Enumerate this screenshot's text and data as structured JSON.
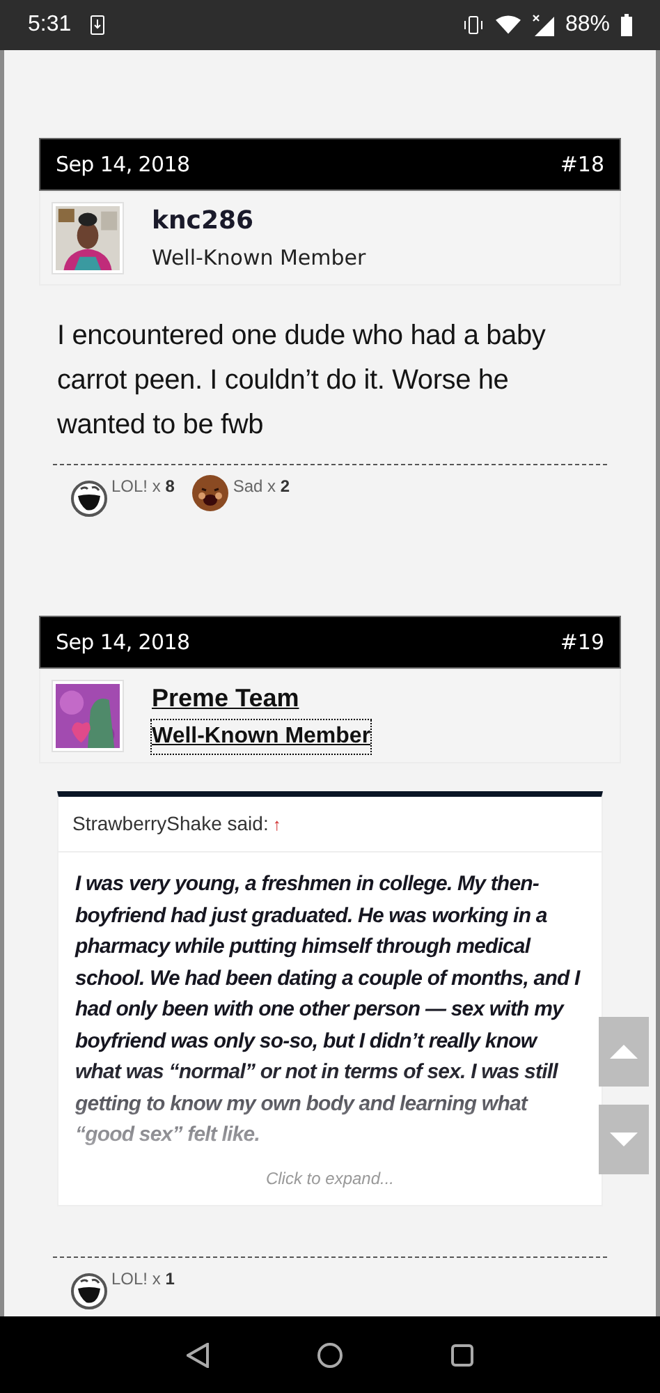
{
  "status_bar": {
    "time": "5:31",
    "battery": "88%"
  },
  "posts": [
    {
      "date": "Sep 14, 2018",
      "number": "#18",
      "username": "knc286",
      "user_title": "Well-Known Member",
      "focused": false,
      "message": "I encountered one dude who had a baby carrot peen. I couldn’t do it. Worse he wanted to be fwb",
      "reactions": [
        {
          "kind": "lol",
          "text": "LOL! x **8**"
        },
        {
          "kind": "sad",
          "text": "Sad x **2**"
        }
      ]
    },
    {
      "date": "Sep 14, 2018",
      "number": "#19",
      "username": "Preme Team",
      "user_title": "Well-Known Member",
      "focused": true,
      "quote": {
        "author": "StrawberryShake said:",
        "arrow": "↑",
        "text": "I was very young, a freshmen in college. My then-boyfriend had just graduated. He was working in a pharmacy while putting himself through medical school. We had been dating a couple of months, and I had only been with one other person — sex with my boyfriend was only so-so, but I didn’t really know what was “normal” or not in terms of sex. I was still getting to know my own body and learning what “good sex” felt like.",
        "expand": "Click to expand..."
      },
      "reactions": [
        {
          "kind": "lol",
          "text": "LOL! x **1**"
        }
      ]
    }
  ]
}
